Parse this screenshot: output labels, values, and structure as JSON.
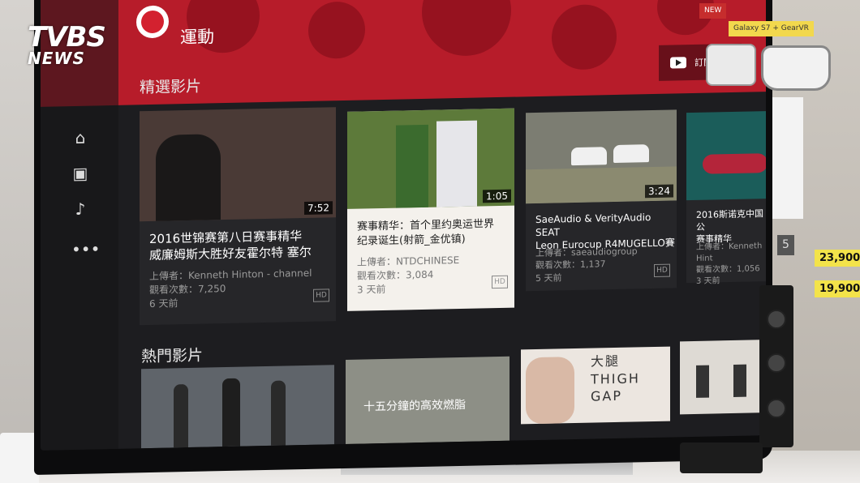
{
  "watermark": {
    "brand": "TVBS",
    "sub": "NEWS"
  },
  "channel": {
    "name": "運動",
    "subscribe_label": "訂閱"
  },
  "sections": [
    {
      "title": "精選影片"
    },
    {
      "title": "熱門影片"
    }
  ],
  "nav_icons": [
    "home-icon",
    "subscriptions-icon",
    "music-icon",
    "more-icon"
  ],
  "featured_videos": [
    {
      "title": "2016世锦赛第八日赛事精华\n威廉姆斯大胜好友霍尔特 塞尔",
      "duration": "7:52",
      "uploader": "上傳者：Kenneth Hinton - channel",
      "views": "觀看次數：7,250",
      "age": "6 天前",
      "hd": "HD",
      "thumb_color": "#4a3a36"
    },
    {
      "title": "赛事精华：首个里约奥运世界\n纪录诞生(射箭_金优镇)",
      "duration": "1:05",
      "uploader": "上傳者：NTDCHINESE",
      "views": "觀看次數：3,084",
      "age": "3 天前",
      "hd": "HD",
      "thumb_color": "#5d7a3a"
    },
    {
      "title": "SaeAudio & VerityAudio SEAT\nLeon Eurocup R4MUGELLO賽",
      "duration": "3:24",
      "uploader": "上傳者：saeaudiogroup",
      "views": "觀看次數：1,137",
      "age": "5 天前",
      "hd": "HD",
      "thumb_color": "#7c7d72"
    },
    {
      "title": "2016斯诺克中国公\n赛事精华",
      "duration": "",
      "uploader": "上傳者：Kenneth Hint",
      "views": "觀看次數：1,056",
      "age": "3 天前",
      "hd": "",
      "thumb_color": "#1b5d5a"
    }
  ],
  "popular_videos": [
    {
      "caption": "",
      "thumb_color": "#5f646a"
    },
    {
      "caption": "十五分鐘的高效燃脂",
      "thumb_color": "#8d8f86"
    },
    {
      "caption": "大腿\nTHIGH GAP",
      "thumb_color": "#ece6e0"
    },
    {
      "caption": "",
      "thumb_color": "#dedad4"
    }
  ],
  "store": {
    "price_1": "23,900",
    "price_2": "19,900",
    "tag_text": "Galaxy S7 + GearVR",
    "sticker": "NEW",
    "num": "5"
  },
  "colors": {
    "banner": "#b71c2a",
    "panel": "#1d1d20",
    "focused_card": "#f4f1ec"
  }
}
